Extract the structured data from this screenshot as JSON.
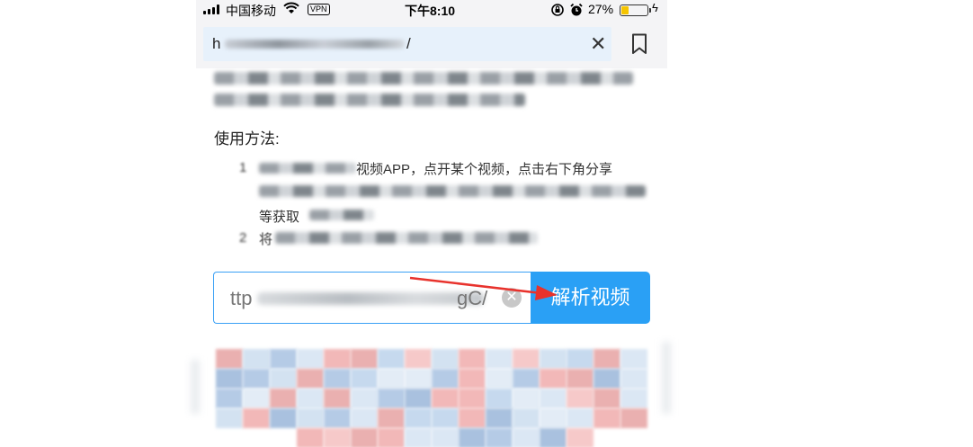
{
  "status_bar": {
    "carrier": "中国移动",
    "vpn": "VPN",
    "time": "下午8:10",
    "battery_percent": "27%",
    "battery_level": 0.27
  },
  "address_bar": {
    "url_prefix": "h",
    "url_suffix": "/",
    "clear_symbol": "✕",
    "bookmark_icon": "bookmark-icon"
  },
  "content": {
    "usage_title": "使用方法:",
    "steps": [
      {
        "number": "1",
        "line1": "视频APP，点开某个视频，点击右下角分享",
        "line2": "",
        "line3": "等获取"
      },
      {
        "number": "2",
        "line1": "将",
        "line2": "",
        "line3": ""
      }
    ]
  },
  "parse_form": {
    "input_value_start": "ttp",
    "input_value_end": "gC/",
    "clear_symbol": "✕",
    "button_label": "解析视频"
  },
  "colors": {
    "accent": "#2aa0f5",
    "arrow": "#e8322c",
    "battery": "#f5c400",
    "url_bg": "#e7f1fb"
  }
}
